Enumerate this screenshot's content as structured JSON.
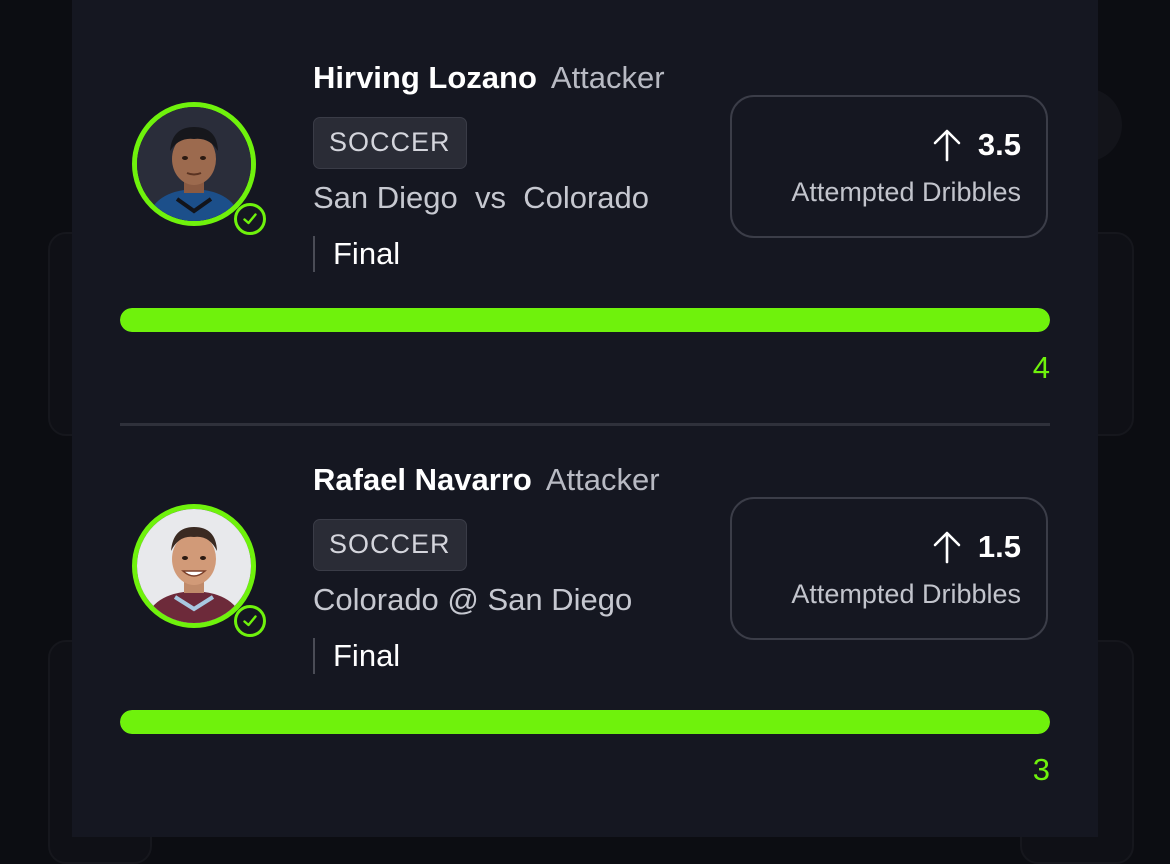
{
  "picks": [
    {
      "player_name": "Hirving Lozano",
      "position": "Attacker",
      "sport": "SOCCER",
      "matchup": "San Diego  vs  Colorado",
      "status": "Final",
      "direction_icon": "arrow-up-icon",
      "line_value": "3.5",
      "stat": "Attempted Dribbles",
      "result": "4",
      "progress_fraction": 1.0,
      "hit": true
    },
    {
      "player_name": "Rafael Navarro",
      "position": "Attacker",
      "sport": "SOCCER",
      "matchup": "Colorado @ San Diego",
      "status": "Final",
      "direction_icon": "arrow-up-icon",
      "line_value": "1.5",
      "stat": "Attempted Dribbles",
      "result": "3",
      "progress_fraction": 1.0,
      "hit": true
    }
  ],
  "colors": {
    "accent": "#6ff20c",
    "modal_bg": "#151721",
    "page_bg": "#0c0d12",
    "badge_bg": "#2a2c36",
    "border": "#3b3d48"
  }
}
